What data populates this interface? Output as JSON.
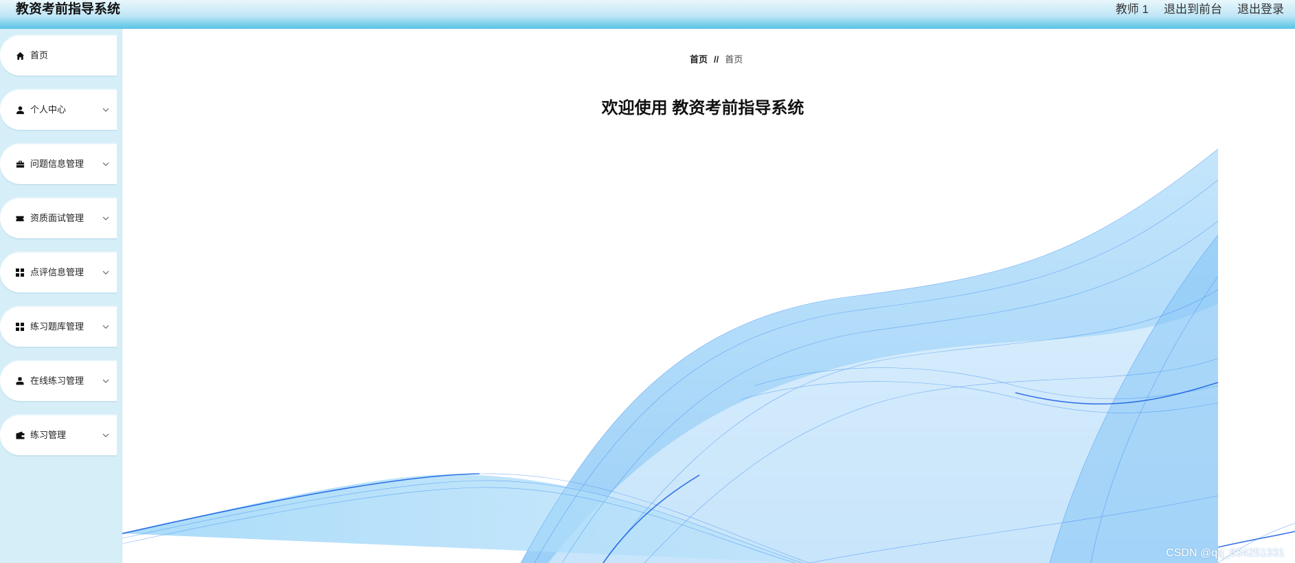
{
  "app": {
    "title": "教资考前指导系统"
  },
  "top_nav": {
    "user": "教师 1",
    "frontend": "退出到前台",
    "logout": "退出登录"
  },
  "sidebar": {
    "items": [
      {
        "label": "首页",
        "icon": "home-icon",
        "expandable": false
      },
      {
        "label": "个人中心",
        "icon": "user-icon",
        "expandable": true
      },
      {
        "label": "问题信息管理",
        "icon": "briefcase-icon",
        "expandable": true
      },
      {
        "label": "资质面试管理",
        "icon": "ticket-icon",
        "expandable": true
      },
      {
        "label": "点评信息管理",
        "icon": "grid-icon",
        "expandable": true
      },
      {
        "label": "练习题库管理",
        "icon": "grid-icon",
        "expandable": true
      },
      {
        "label": "在线练习管理",
        "icon": "person-icon",
        "expandable": true
      },
      {
        "label": "练习管理",
        "icon": "wallet-icon",
        "expandable": true
      }
    ]
  },
  "breadcrumb": {
    "home": "首页",
    "separator": "//",
    "current": "首页"
  },
  "main": {
    "welcome": "欢迎使用 教资考前指导系统"
  },
  "watermark": "CSDN @qq_834251331",
  "colors": {
    "header_gradient_top": "#eaf7fc",
    "header_gradient_bottom": "#57c3e6",
    "sidebar_bg": "#d6eef8",
    "wave_blue": "#1e78f0"
  }
}
